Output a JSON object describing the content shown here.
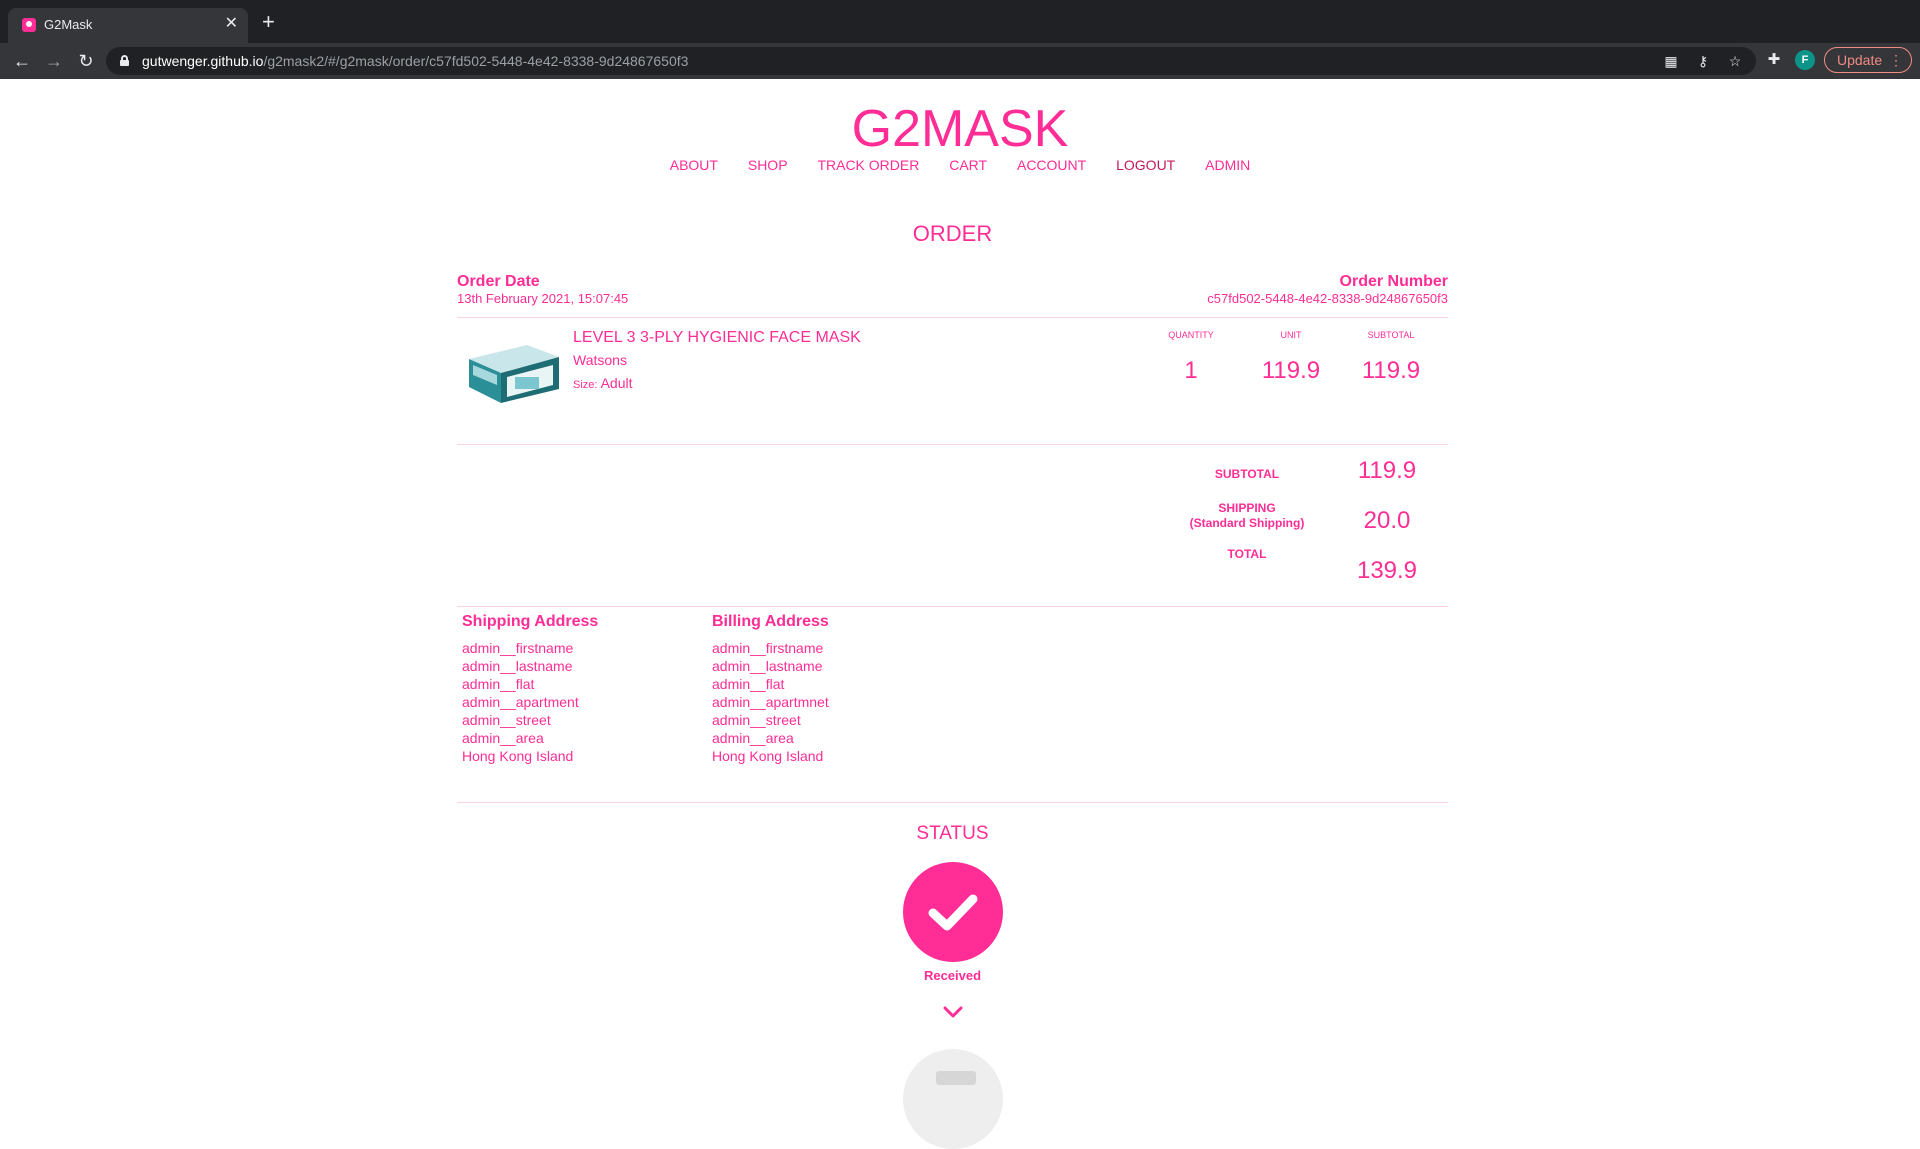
{
  "browser": {
    "tab_title": "G2Mask",
    "url_host": "gutwenger.github.io",
    "url_path": "/g2mask2/#/g2mask/order/c57fd502-5448-4e42-8338-9d24867650f3",
    "profile_initial": "F",
    "update_label": "Update"
  },
  "site": {
    "brand": "G2MASK",
    "nav": [
      "ABOUT",
      "SHOP",
      "TRACK ORDER",
      "CART",
      "ACCOUNT",
      "LOGOUT",
      "ADMIN"
    ]
  },
  "order": {
    "heading": "ORDER",
    "date_label": "Order Date",
    "date_value": "13th February 2021, 15:07:45",
    "number_label": "Order Number",
    "number_value": "c57fd502-5448-4e42-8338-9d24867650f3",
    "item": {
      "name": "LEVEL 3 3-PLY HYGIENIC FACE MASK",
      "brand": "Watsons",
      "size_label": "Size:",
      "size_value": "Adult",
      "quantity_label": "QUANTITY",
      "unit_label": "UNIT",
      "subtotal_label": "SUBTOTAL",
      "quantity": "1",
      "unit": "119.9",
      "subtotal": "119.9"
    },
    "totals": {
      "subtotal_label": "SUBTOTAL",
      "subtotal": "119.9",
      "shipping_label": "SHIPPING",
      "shipping_method": "(Standard Shipping)",
      "shipping": "20.0",
      "total_label": "TOTAL",
      "total": "139.9"
    },
    "shipping_address": {
      "title": "Shipping Address",
      "lines": [
        "admin__firstname",
        "admin__lastname",
        "admin__flat",
        "admin__apartment",
        "admin__street",
        "admin__area",
        "Hong Kong Island"
      ]
    },
    "billing_address": {
      "title": "Billing Address",
      "lines": [
        "admin__firstname",
        "admin__lastname",
        "admin__flat",
        "admin__apartmnet",
        "admin__street",
        "admin__area",
        "Hong Kong Island"
      ]
    },
    "status": {
      "heading": "STATUS",
      "current": "Received"
    }
  },
  "colors": {
    "accent": "#ff2d95",
    "nav_active": "#c2185b",
    "chrome_bg": "#202124"
  }
}
